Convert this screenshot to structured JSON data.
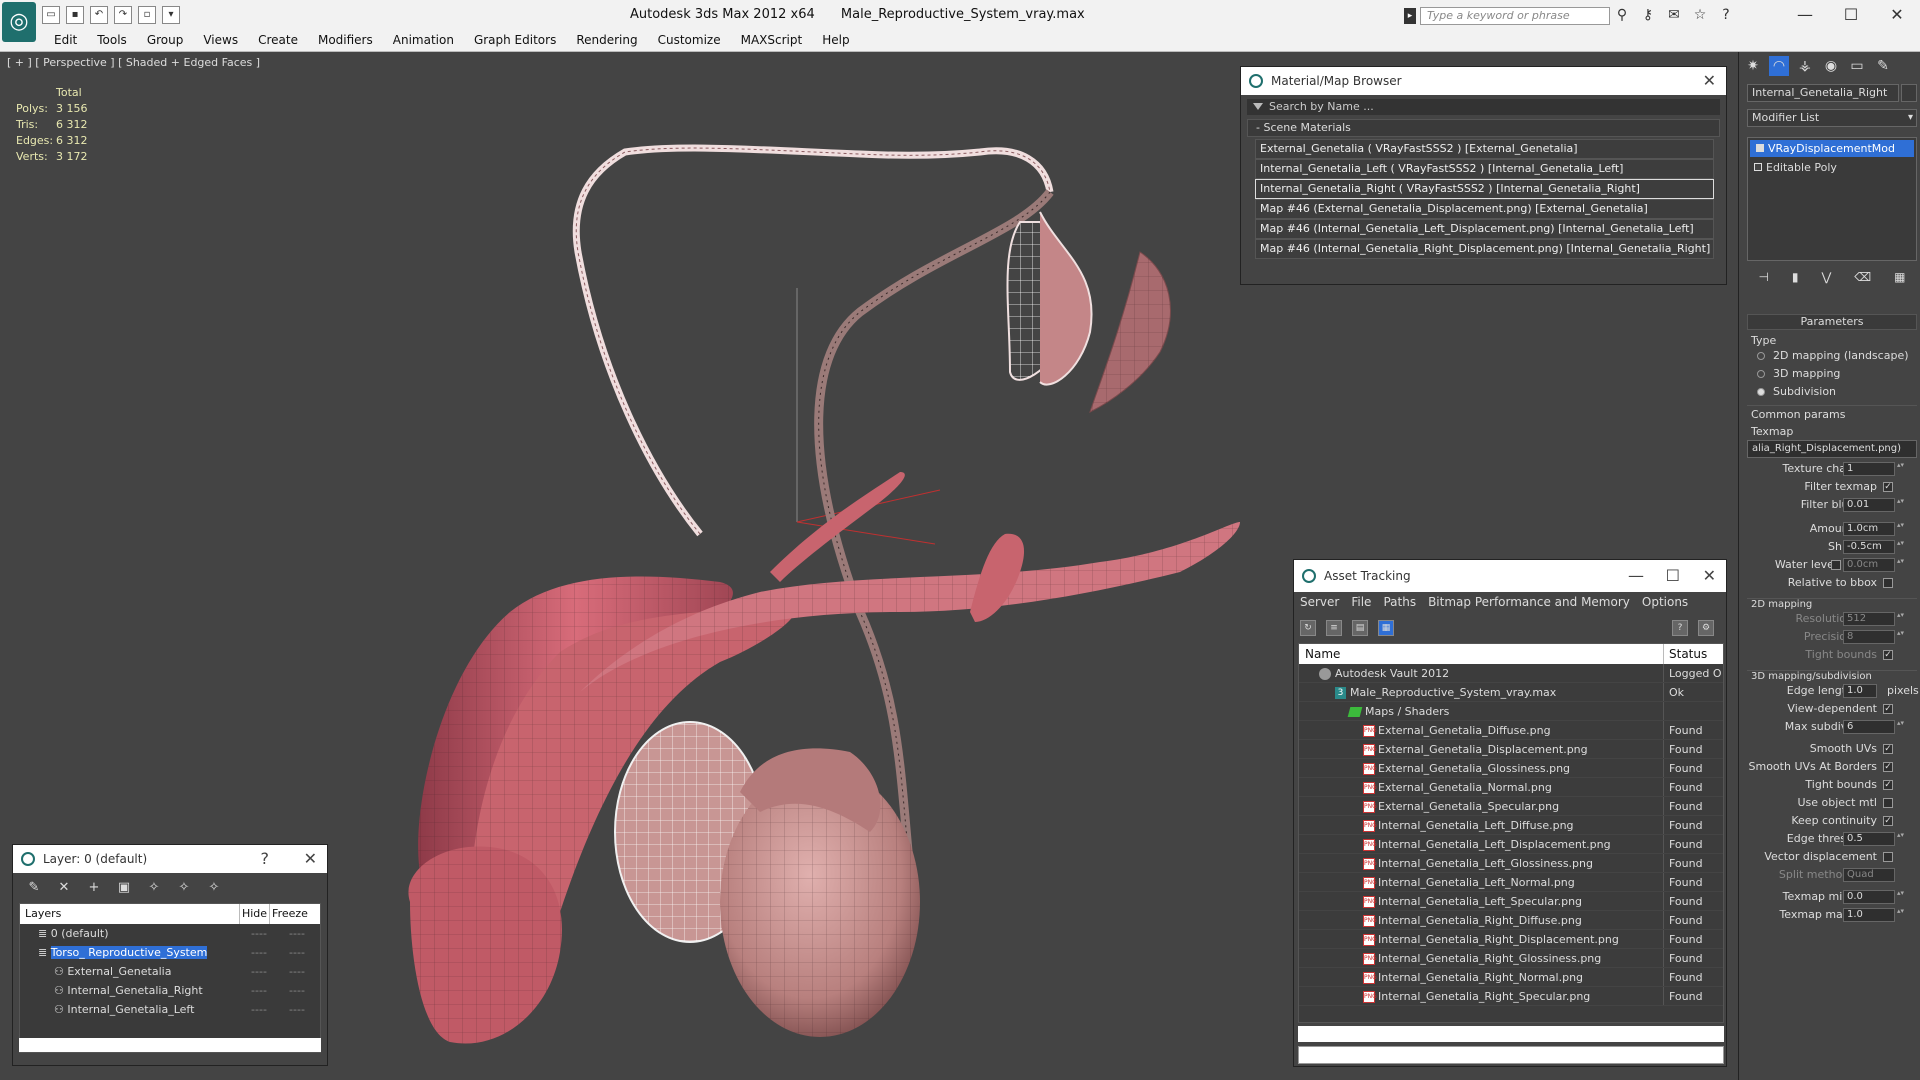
{
  "titlebar": {
    "app": "Autodesk 3ds Max  2012 x64",
    "file": "Male_Reproductive_System_vray.max",
    "search_placeholder": "Type a keyword or phrase"
  },
  "menu": [
    "Edit",
    "Tools",
    "Group",
    "Views",
    "Create",
    "Modifiers",
    "Animation",
    "Graph Editors",
    "Rendering",
    "Customize",
    "MAXScript",
    "Help"
  ],
  "viewport": {
    "label": "[ + ] [ Perspective ] [ Shaded + Edged Faces ]",
    "stats": {
      "header": "Total",
      "rows": [
        {
          "k": "Polys:",
          "v": "3 156"
        },
        {
          "k": "Tris:",
          "v": "6 312"
        },
        {
          "k": "Edges:",
          "v": "6 312"
        },
        {
          "k": "Verts:",
          "v": "3 172"
        }
      ]
    }
  },
  "material_browser": {
    "title": "Material/Map Browser",
    "search_placeholder": "Search by Name ...",
    "group": "- Scene Materials",
    "items": [
      "External_Genetalia  ( VRayFastSSS2 )  [External_Genetalia]",
      "Internal_Genetalia_Left  ( VRayFastSSS2 )  [Internal_Genetalia_Left]",
      "Internal_Genetalia_Right  ( VRayFastSSS2 )  [Internal_Genetalia_Right]",
      "Map #46 (External_Genetalia_Displacement.png)  [External_Genetalia]",
      "Map #46 (Internal_Genetalia_Left_Displacement.png)  [Internal_Genetalia_Left]",
      "Map #46 (Internal_Genetalia_Right_Displacement.png)  [Internal_Genetalia_Right]"
    ],
    "selected_index": 2
  },
  "asset_tracking": {
    "title": "Asset Tracking",
    "menu": [
      "Server",
      "File",
      "Paths",
      "Bitmap Performance and Memory",
      "Options"
    ],
    "col_name": "Name",
    "col_status": "Status",
    "rows": [
      {
        "name": "Autodesk Vault 2012",
        "status": "Logged O",
        "indent": 20,
        "icon": "vault"
      },
      {
        "name": "Male_Reproductive_System_vray.max",
        "status": "Ok",
        "indent": 36,
        "icon": "max"
      },
      {
        "name": "Maps / Shaders",
        "status": "",
        "indent": 50,
        "icon": "folder"
      },
      {
        "name": "External_Genetalia_Diffuse.png",
        "status": "Found",
        "indent": 64,
        "icon": "png"
      },
      {
        "name": "External_Genetalia_Displacement.png",
        "status": "Found",
        "indent": 64,
        "icon": "png"
      },
      {
        "name": "External_Genetalia_Glossiness.png",
        "status": "Found",
        "indent": 64,
        "icon": "png"
      },
      {
        "name": "External_Genetalia_Normal.png",
        "status": "Found",
        "indent": 64,
        "icon": "png"
      },
      {
        "name": "External_Genetalia_Specular.png",
        "status": "Found",
        "indent": 64,
        "icon": "png"
      },
      {
        "name": "Internal_Genetalia_Left_Diffuse.png",
        "status": "Found",
        "indent": 64,
        "icon": "png"
      },
      {
        "name": "Internal_Genetalia_Left_Displacement.png",
        "status": "Found",
        "indent": 64,
        "icon": "png"
      },
      {
        "name": "Internal_Genetalia_Left_Glossiness.png",
        "status": "Found",
        "indent": 64,
        "icon": "png"
      },
      {
        "name": "Internal_Genetalia_Left_Normal.png",
        "status": "Found",
        "indent": 64,
        "icon": "png"
      },
      {
        "name": "Internal_Genetalia_Left_Specular.png",
        "status": "Found",
        "indent": 64,
        "icon": "png"
      },
      {
        "name": "Internal_Genetalia_Right_Diffuse.png",
        "status": "Found",
        "indent": 64,
        "icon": "png"
      },
      {
        "name": "Internal_Genetalia_Right_Displacement.png",
        "status": "Found",
        "indent": 64,
        "icon": "png"
      },
      {
        "name": "Internal_Genetalia_Right_Glossiness.png",
        "status": "Found",
        "indent": 64,
        "icon": "png"
      },
      {
        "name": "Internal_Genetalia_Right_Normal.png",
        "status": "Found",
        "indent": 64,
        "icon": "png"
      },
      {
        "name": "Internal_Genetalia_Right_Specular.png",
        "status": "Found",
        "indent": 64,
        "icon": "png"
      }
    ]
  },
  "layer_dialog": {
    "title": "Layer: 0 (default)",
    "help": "?",
    "col_layers": "Layers",
    "col_hide": "Hide",
    "col_freeze": "Freeze",
    "rows": [
      {
        "name": "0 (default)",
        "indent": 18,
        "selected": false
      },
      {
        "name": "Torso_ Reproductive_System",
        "indent": 18,
        "selected": true
      },
      {
        "name": "External_Genetalia",
        "indent": 34,
        "selected": false
      },
      {
        "name": "Internal_Genetalia_Right",
        "indent": 34,
        "selected": false
      },
      {
        "name": "Internal_Genetalia_Left",
        "indent": 34,
        "selected": false
      }
    ],
    "dash": "----"
  },
  "command_panel": {
    "object_name": "Internal_Genetalia_Right",
    "modifier_list": "Modifier List",
    "stack": [
      {
        "name": "VRayDisplacementMod",
        "active": true
      },
      {
        "name": "Editable Poly",
        "active": false
      }
    ],
    "params_title": "Parameters",
    "type_label": "Type",
    "type_options": [
      {
        "label": "2D mapping (landscape)",
        "on": false
      },
      {
        "label": "3D mapping",
        "on": false
      },
      {
        "label": "Subdivision",
        "on": true
      }
    ],
    "common_params": "Common params",
    "texmap_label": "Texmap",
    "texmap_value": "alia_Right_Displacement.png)",
    "texture_chan_label": "Texture chan",
    "texture_chan": "1",
    "filter_texmap": "Filter texmap",
    "filter_blur_label": "Filter blur",
    "filter_blur": "0.01",
    "amount_label": "Amount",
    "amount": "1.0cm",
    "shift_label": "Shift",
    "shift": "-0.5cm",
    "water_label": "Water level",
    "water": "0.0cm",
    "rel_bbox": "Relative to bbox",
    "mapping_2d": "2D mapping",
    "resolution_label": "Resolution",
    "resolution": "512",
    "precision_label": "Precision",
    "precision": "8",
    "tight_bounds": "Tight bounds",
    "mapping_3d": "3D mapping/subdivision",
    "edge_length_label": "Edge length",
    "edge_length": "1.0",
    "pixels": "pixels",
    "view_dependent": "View-dependent",
    "max_subdivs_label": "Max subdivs",
    "max_subdivs": "6",
    "smooth_uvs": "Smooth UVs",
    "smooth_uvs_borders": "Smooth UVs At Borders",
    "tight_bounds2": "Tight bounds",
    "use_object_mtl": "Use object mtl",
    "keep_continuity": "Keep continuity",
    "edge_thresh_label": "Edge thresh",
    "edge_thresh": "0.5",
    "vector_disp": "Vector displacement",
    "split_method_label": "Split method:",
    "split_method": "Quad",
    "texmap_min_label": "Texmap min:",
    "texmap_min": "0.0",
    "texmap_max_label": "Texmap max:",
    "texmap_max": "1.0"
  },
  "colors": {
    "viewport_bg": "#444444",
    "selection": "#2f6fd6",
    "mesh_flesh": "#c8646e",
    "mesh_light": "#d8a2a4"
  }
}
